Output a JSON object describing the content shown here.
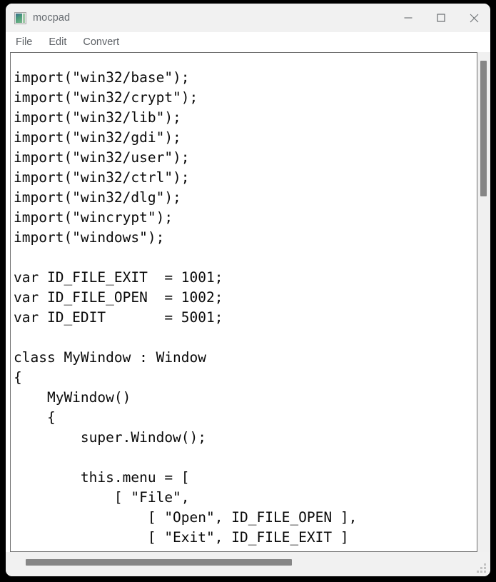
{
  "window": {
    "title": "mocpad",
    "icon": "image-file-icon",
    "controls": {
      "minimize": "minimize-icon",
      "maximize": "maximize-icon",
      "close": "close-icon"
    },
    "chrome_color": "#f1f1f1",
    "desktop_background": "#000000"
  },
  "menubar": {
    "items": [
      {
        "label": "File"
      },
      {
        "label": "Edit"
      },
      {
        "label": "Convert"
      }
    ]
  },
  "editor": {
    "font": "monospace",
    "text_color": "#0a0a0a",
    "background": "#ffffff",
    "lines": [
      "import(\"win32/base\");",
      "import(\"win32/crypt\");",
      "import(\"win32/lib\");",
      "import(\"win32/gdi\");",
      "import(\"win32/user\");",
      "import(\"win32/ctrl\");",
      "import(\"win32/dlg\");",
      "import(\"wincrypt\");",
      "import(\"windows\");",
      "",
      "var ID_FILE_EXIT  = 1001;",
      "var ID_FILE_OPEN  = 1002;",
      "var ID_EDIT       = 5001;",
      "",
      "class MyWindow : Window",
      "{",
      "    MyWindow()",
      "    {",
      "        super.Window();",
      "",
      "        this.menu = [",
      "            [ \"File\",",
      "                [ \"Open\", ID_FILE_OPEN ],",
      "                [ \"Exit\", ID_FILE_EXIT ]",
      "            ]"
    ]
  },
  "scrollbars": {
    "vertical": {
      "thumb_color": "#868686",
      "track_color": "#f0f0f0"
    },
    "horizontal": {
      "thumb_color": "#868686",
      "track_color": "#f1f1f1"
    }
  },
  "resize_grip": "resize-grip-icon"
}
